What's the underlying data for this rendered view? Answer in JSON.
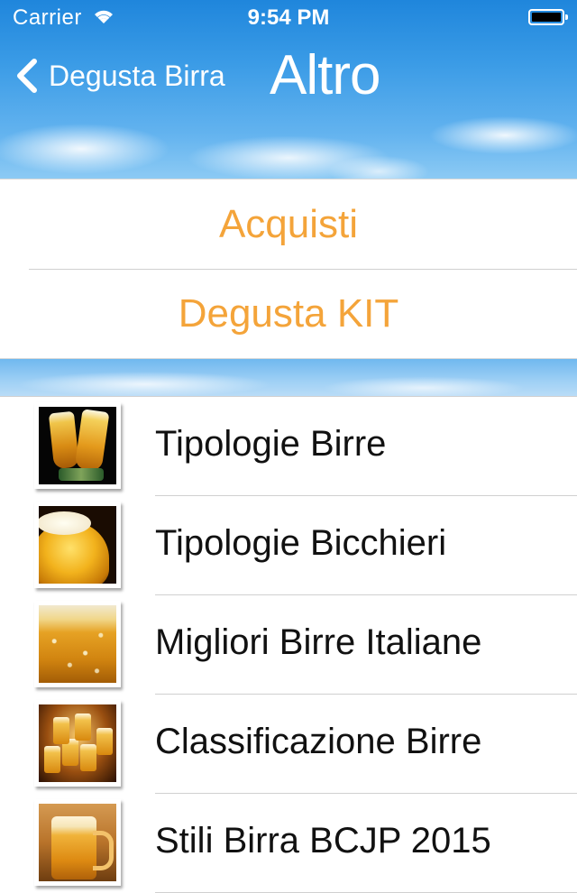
{
  "status_bar": {
    "carrier": "Carrier",
    "time": "9:54 PM",
    "wifi_icon": "wifi-icon",
    "battery_icon": "battery-icon"
  },
  "nav": {
    "back_label": "Degusta Birra",
    "back_icon": "chevron-left-icon",
    "title": "Altro"
  },
  "actions": [
    {
      "label": "Acquisti"
    },
    {
      "label": "Degusta KIT"
    }
  ],
  "action_color": "#f4a43a",
  "menu": [
    {
      "label": "Tipologie Birre",
      "thumbnail": "two-beer-glasses-image"
    },
    {
      "label": "Tipologie Bicchieri",
      "thumbnail": "beer-glass-foam-image"
    },
    {
      "label": "Migliori Birre Italiane",
      "thumbnail": "beer-bubbles-image"
    },
    {
      "label": "Classificazione Birre",
      "thumbnail": "beer-mugs-image"
    },
    {
      "label": "Stili Birra BCJP 2015",
      "thumbnail": "beer-mug-image"
    }
  ]
}
